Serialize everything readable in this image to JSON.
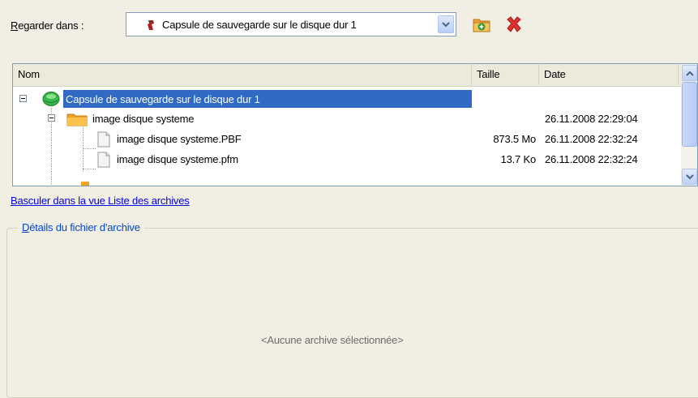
{
  "lookin": {
    "label_access": "R",
    "label_rest": "egarder dans :",
    "selected": "Capsule de sauvegarde sur le disque dur 1"
  },
  "toolbar": {
    "icons": [
      "new-folder-icon",
      "delete-icon"
    ]
  },
  "tree": {
    "columns": {
      "name": "Nom",
      "size": "Taille",
      "date": "Date"
    },
    "rows": [
      {
        "name": "Capsule de sauvegarde sur le disque dur 1",
        "size": "",
        "date": "",
        "selected": true,
        "icon": "backup-capsule-icon"
      },
      {
        "name": "image disque systeme",
        "size": "",
        "date": "26.11.2008 22:29:04",
        "icon": "folder-icon"
      },
      {
        "name": "image disque systeme.PBF",
        "size": "873.5 Mo",
        "date": "26.11.2008 22:32:24",
        "icon": "file-icon"
      },
      {
        "name": "image disque systeme.pfm",
        "size": "13.7 Ko",
        "date": "26.11.2008 22:32:24",
        "icon": "file-icon"
      }
    ]
  },
  "switch_link": "Basculer dans la vue Liste des archives",
  "details": {
    "title_access": "D",
    "title_rest": "étails du fichier d'archive",
    "empty": "<Aucune archive sélectionnée>"
  },
  "colors": {
    "selection": "#316ac5",
    "background": "#f1efe3",
    "link": "#0000ee",
    "group_title": "#0046d5"
  }
}
